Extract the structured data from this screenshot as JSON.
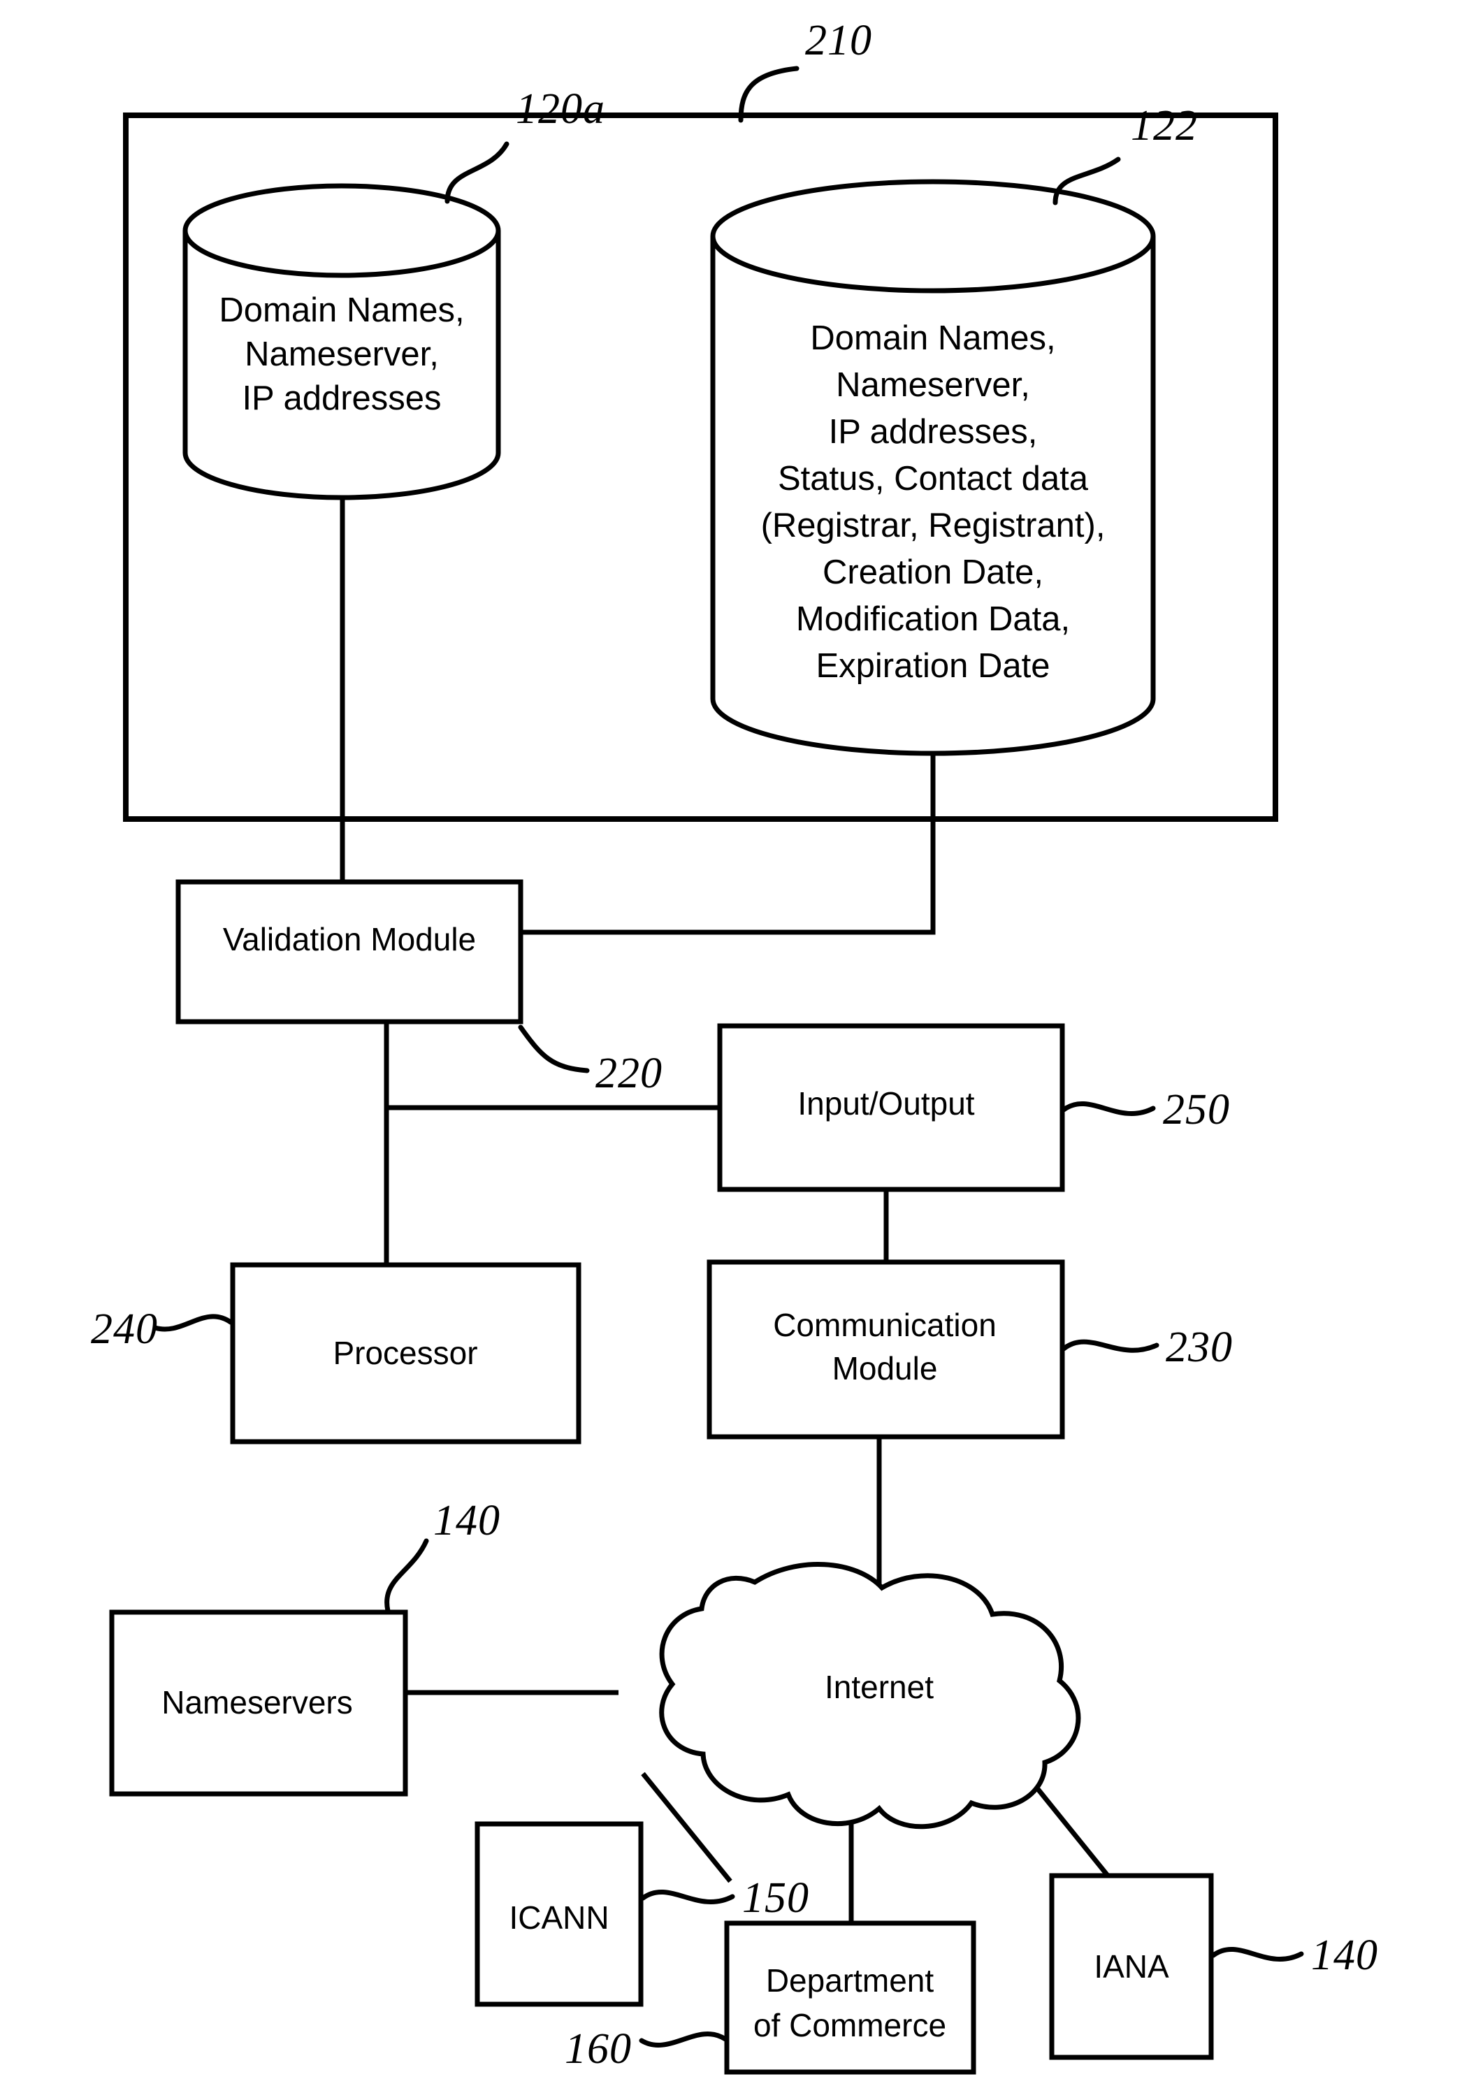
{
  "figure": {
    "type": "patent-block-diagram",
    "background": "#ffffff",
    "ink": "#000000"
  },
  "reference_numerals": {
    "system_boundary": "210",
    "datastore_left": "120a",
    "datastore_right": "122",
    "validation_module": "220",
    "input_output": "250",
    "processor": "240",
    "communication_module": "230",
    "nameservers": "140",
    "icann": "150",
    "department_of_commerce": "160",
    "iana": "140"
  },
  "datastores": {
    "left": {
      "id": "120a",
      "lines": [
        "Domain Names,",
        "Nameserver,",
        "IP addresses"
      ]
    },
    "right": {
      "id": "122",
      "lines": [
        "Domain Names,",
        "Nameserver,",
        "IP addresses,",
        "Status, Contact data",
        "(Registrar, Registrant),",
        "Creation Date,",
        "Modification Data,",
        "Expiration Date"
      ]
    }
  },
  "blocks": {
    "validation_module": {
      "label": "Validation Module",
      "ref": "220"
    },
    "input_output": {
      "label": "Input/Output",
      "ref": "250"
    },
    "processor": {
      "label": "Processor",
      "ref": "240"
    },
    "communication_module": {
      "lines": [
        "Communication",
        "Module"
      ],
      "ref": "230"
    },
    "nameservers": {
      "label": "Nameservers",
      "ref": "140"
    },
    "icann": {
      "label": "ICANN",
      "ref": "150"
    },
    "department_of_commerce": {
      "lines": [
        "Department",
        "of Commerce"
      ],
      "ref": "160"
    },
    "iana": {
      "label": "IANA",
      "ref": "140"
    }
  },
  "network": {
    "cloud": {
      "label": "Internet"
    }
  }
}
